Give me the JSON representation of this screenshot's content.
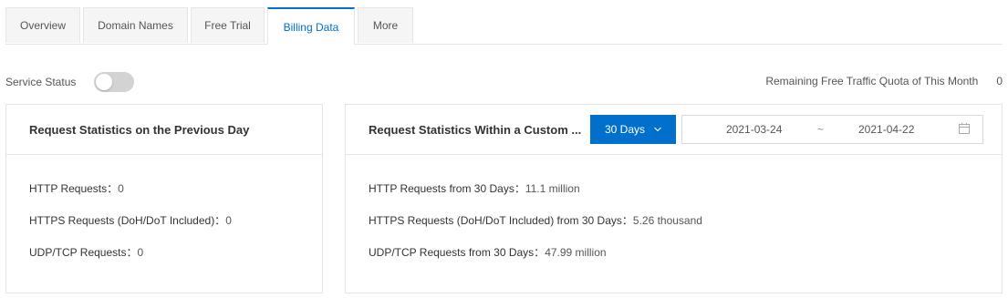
{
  "tabs": [
    {
      "label": "Overview"
    },
    {
      "label": "Domain Names"
    },
    {
      "label": "Free Trial"
    },
    {
      "label": "Billing Data",
      "active": true
    },
    {
      "label": "More"
    }
  ],
  "service_status": {
    "label": "Service Status",
    "enabled": false
  },
  "quota": {
    "label": "Remaining Free Traffic Quota of This Month",
    "value": "0"
  },
  "previous_day": {
    "title": "Request Statistics on the Previous Day",
    "http_label": "HTTP Requests：",
    "http_value": "0",
    "https_label": "HTTPS Requests (DoH/DoT Included)：",
    "https_value": "0",
    "udp_label": "UDP/TCP Requests：",
    "udp_value": "0"
  },
  "custom_range": {
    "title": "Request Statistics Within a Custom ...",
    "period_button": "30 Days",
    "start_date": "2021-03-24",
    "separator": "~",
    "end_date": "2021-04-22",
    "http_label": "HTTP Requests from 30 Days：",
    "http_value": "11.1 million",
    "https_label": "HTTPS Requests (DoH/DoT Included) from 30 Days：",
    "https_value": "5.26 thousand",
    "udp_label": "UDP/TCP Requests from 30 Days：",
    "udp_value": "47.99 million"
  },
  "colors": {
    "accent": "#0070cc",
    "toggle_off": "#d3d3d3",
    "border": "#e6e6e6"
  },
  "icons": {
    "dropdown": "chevron-down-icon",
    "calendar": "calendar-icon"
  }
}
